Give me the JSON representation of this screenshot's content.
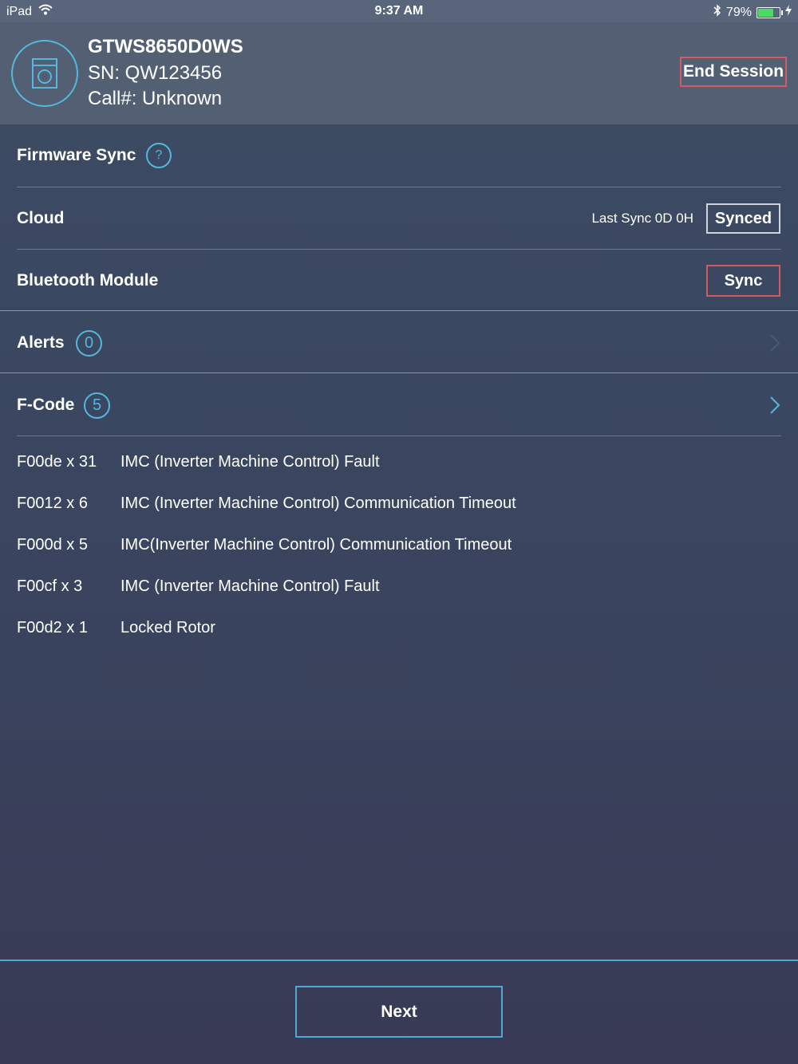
{
  "status_bar": {
    "device": "iPad",
    "time": "9:37 AM",
    "battery_percent": "79%",
    "battery_level": 0.79,
    "wifi_icon": "wifi-icon",
    "bluetooth_icon": "bluetooth-icon",
    "charging_icon": "bolt-icon"
  },
  "header": {
    "model": "GTWS8650D0WS",
    "sn": "SN: QW123456",
    "call": "Call#: Unknown",
    "end_session_label": "End Session",
    "device_icon": "washer-icon"
  },
  "firmware_sync": {
    "title": "Firmware Sync",
    "help": "?"
  },
  "cloud": {
    "title": "Cloud",
    "last_sync": "Last Sync 0D 0H",
    "status_label": "Synced"
  },
  "bluetooth_module": {
    "title": "Bluetooth Module",
    "action_label": "Sync"
  },
  "alerts": {
    "title": "Alerts",
    "count": "0"
  },
  "fcode": {
    "title": "F-Code",
    "count": "5",
    "items": [
      {
        "code": "F00de x 31",
        "desc": "IMC (Inverter Machine Control) Fault"
      },
      {
        "code": "F0012 x 6",
        "desc": "IMC (Inverter Machine Control) Communication Timeout"
      },
      {
        "code": "F000d x 5",
        "desc": "IMC(Inverter Machine Control) Communication Timeout"
      },
      {
        "code": "F00cf x 3",
        "desc": "IMC (Inverter Machine Control) Fault"
      },
      {
        "code": "F00d2 x 1",
        "desc": "Locked Rotor"
      }
    ]
  },
  "footer": {
    "next_label": "Next"
  },
  "colors": {
    "accent": "#55b7dd",
    "danger": "#d25a62",
    "header_bg": "#536074",
    "body_bg": "#3c4862"
  }
}
